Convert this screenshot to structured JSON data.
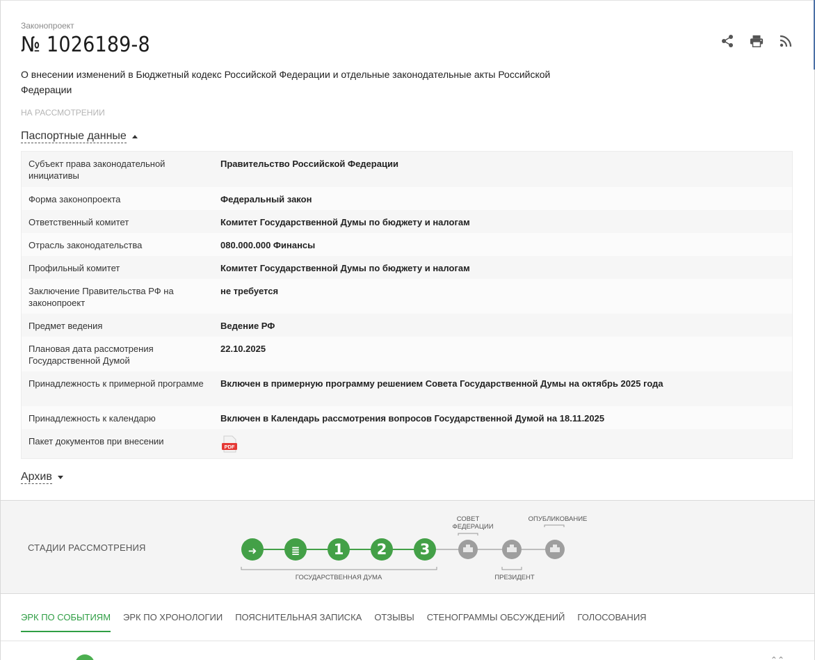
{
  "header": {
    "kicker": "Законопроект",
    "number": "№ 1026189-8",
    "title": "О внесении изменений в Бюджетный кодекс Российской Федерации и отдельные законодательные акты Российской Федерации",
    "status": "НА РАССМОТРЕНИИ"
  },
  "actions": {
    "share_icon": "share-icon",
    "print_icon": "print-icon",
    "rss_icon": "rss-icon"
  },
  "passport": {
    "toggle_label": "Паспортные данные",
    "rows": [
      {
        "key": "Субъект права законодательной инициативы",
        "value": "Правительство Российской Федерации"
      },
      {
        "key": "Форма законопроекта",
        "value": "Федеральный закон"
      },
      {
        "key": "Ответственный комитет",
        "value": "Комитет Государственной Думы по бюджету и налогам"
      },
      {
        "key": "Отрасль законодательства",
        "value": "080.000.000 Финансы"
      },
      {
        "key": "Профильный комитет",
        "value": "Комитет Государственной Думы по бюджету и налогам"
      },
      {
        "key": "Заключение Правительства РФ на законопроект",
        "value": "не требуется"
      },
      {
        "key": "Предмет ведения",
        "value": "Ведение РФ"
      },
      {
        "key": "Плановая дата рассмотрения Государственной Думой",
        "value": "22.10.2025"
      },
      {
        "key": "Принадлежность к примерной программе",
        "value": "Включен в примерную программу решением Совета Государственной Думы на октябрь 2025 года"
      },
      {
        "key": "Принадлежность к календарю",
        "value": "Включен в Календарь рассмотрения вопросов Государственной Думой на 18.11.2025"
      },
      {
        "key": "Пакет документов при внесении",
        "value": ""
      }
    ],
    "pdf_label": "PDF"
  },
  "archive": {
    "toggle_label": "Архив"
  },
  "stages": {
    "label": "СТАДИИ РАССМОТРЕНИЯ",
    "duma_label": "ГОСУДАРСТВЕННАЯ ДУМА",
    "council_label_1": "СОВЕТ",
    "council_label_2": "ФЕДЕРАЦИИ",
    "president_label": "ПРЕЗИДЕНТ",
    "publish_label": "ОПУБЛИКОВАНИЕ",
    "steps": [
      {
        "name": "introduction",
        "glyph": "➜",
        "state": "done"
      },
      {
        "name": "preliminary",
        "glyph": "≣",
        "state": "done"
      },
      {
        "name": "reading-1",
        "glyph": "1",
        "state": "done"
      },
      {
        "name": "reading-2",
        "glyph": "2",
        "state": "done"
      },
      {
        "name": "reading-3",
        "glyph": "3",
        "state": "done"
      },
      {
        "name": "federation-council",
        "glyph": "",
        "state": "pending"
      },
      {
        "name": "president",
        "glyph": "",
        "state": "pending"
      },
      {
        "name": "publication",
        "glyph": "",
        "state": "pending"
      }
    ],
    "colors": {
      "done": "#43a047",
      "pending": "#9e9e9e",
      "line": "#bdbdbd"
    }
  },
  "tabs": [
    {
      "label": "ЭРК ПО СОБЫТИЯМ",
      "active": true
    },
    {
      "label": "ЭРК ПО ХРОНОЛОГИИ",
      "active": false
    },
    {
      "label": "ПОЯСНИТЕЛЬНАЯ ЗАПИСКА",
      "active": false
    },
    {
      "label": "ОТЗЫВЫ",
      "active": false
    },
    {
      "label": "СТЕНОГРАММЫ ОБСУЖДЕНИЙ",
      "active": false
    },
    {
      "label": "ГОЛОСОВАНИЯ",
      "active": false
    }
  ]
}
